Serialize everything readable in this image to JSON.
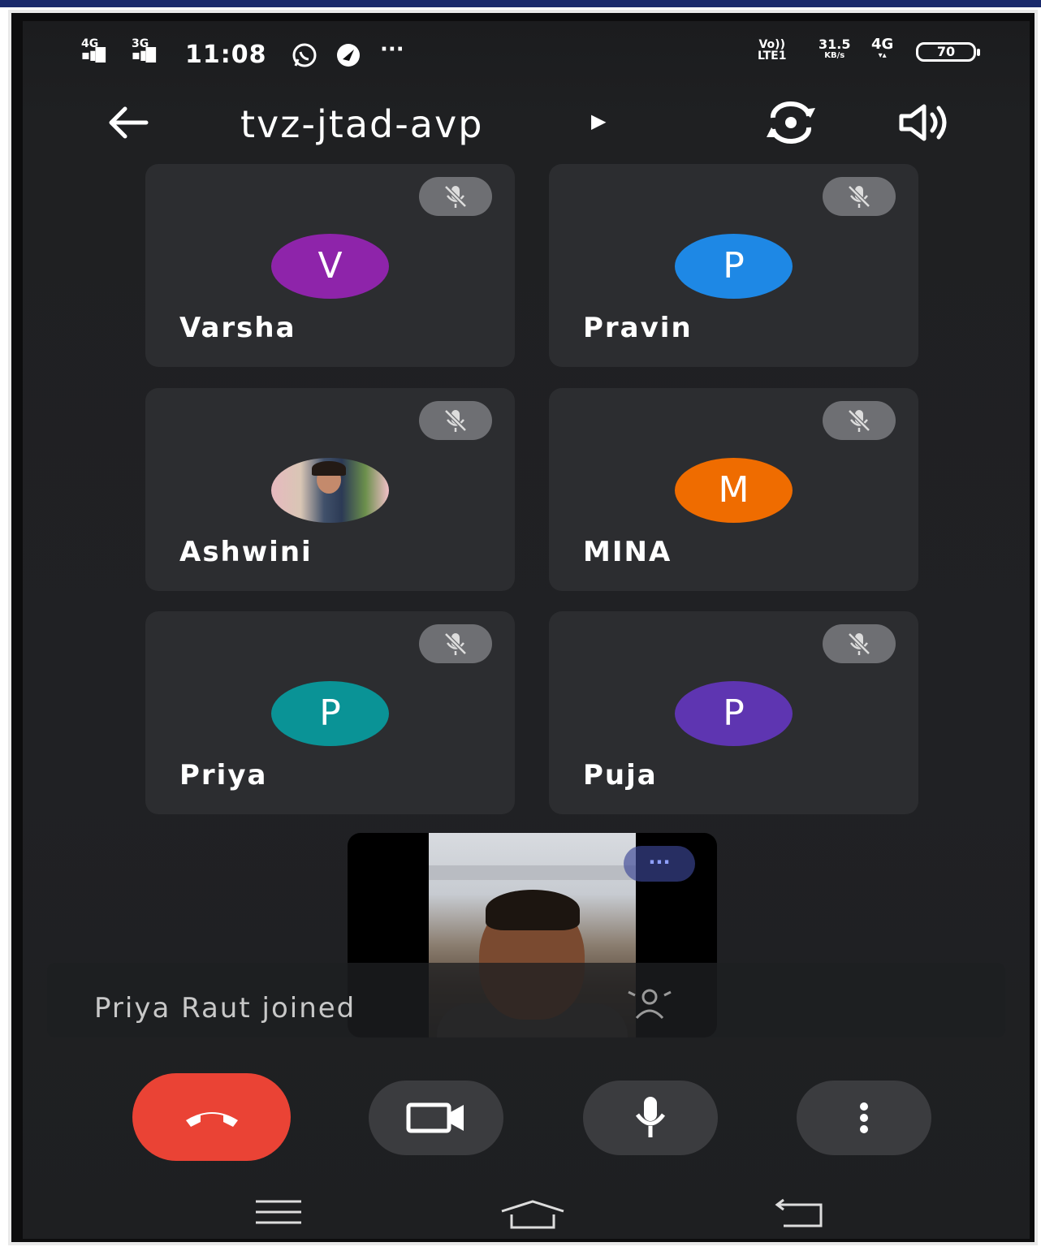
{
  "status_bar": {
    "sim1_type": "4G",
    "sim2_type": "3G",
    "time": "11:08",
    "more_indicator": "···",
    "volte_top": "Vo))",
    "volte_bottom": "LTE1",
    "speed_value": "31.5",
    "speed_unit": "KB/s",
    "net_type": "4G",
    "battery": "70"
  },
  "app_bar": {
    "meeting_code": "tvz-jtad-avp",
    "back_icon": "arrow-left-icon",
    "switch_camera_icon": "switch-camera-icon",
    "speaker_icon": "speaker-icon"
  },
  "participants": [
    {
      "name": "Varsha",
      "initial": "V",
      "color": "#8e24aa",
      "muted": true
    },
    {
      "name": "Pravin",
      "initial": "P",
      "color": "#1e88e5",
      "muted": true
    },
    {
      "name": "Ashwini",
      "initial": "",
      "color": "#e8c8c8",
      "muted": true,
      "photo": true
    },
    {
      "name": "MINA",
      "initial": "M",
      "color": "#ef6c00",
      "muted": true
    },
    {
      "name": "Priya",
      "initial": "P",
      "color": "#0a9396",
      "muted": true
    },
    {
      "name": "Puja",
      "initial": "P",
      "color": "#5e35b1",
      "muted": true
    }
  ],
  "self_view": {
    "more_label": "···"
  },
  "notification": "Priya Raut joined",
  "controls": {
    "end_call_color": "#ea4335",
    "button_color": "#3b3c3f"
  }
}
